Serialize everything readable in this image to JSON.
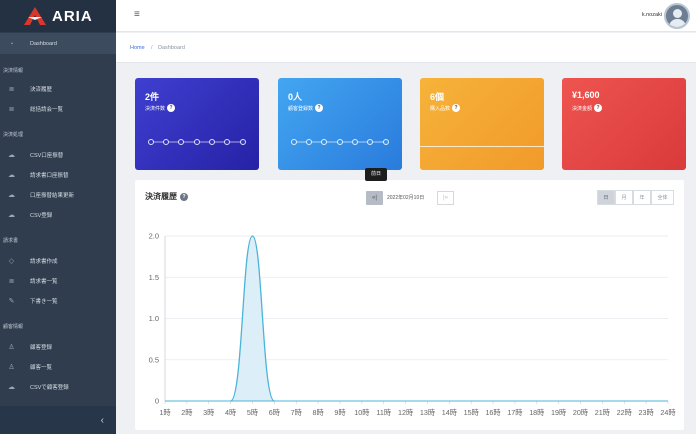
{
  "app": {
    "name": "ARIA",
    "brand_color": "#d9372b"
  },
  "sidebar": {
    "dashboard": {
      "label": "Dashboard",
      "icon": "dashboard-icon"
    },
    "sections": [
      {
        "title": "決済情報",
        "items": [
          {
            "label": "決済履歴",
            "icon": "document-icon"
          },
          {
            "label": "総括請会一覧",
            "icon": "document-icon"
          }
        ]
      },
      {
        "title": "決済処理",
        "items": [
          {
            "label": "CSV口座振替",
            "icon": "upload-icon"
          },
          {
            "label": "請求書口座振替",
            "icon": "upload-icon"
          },
          {
            "label": "口座振替結果更新",
            "icon": "upload-icon"
          },
          {
            "label": "CSV登録",
            "icon": "upload-icon"
          }
        ]
      },
      {
        "title": "請求書",
        "items": [
          {
            "label": "請求書作成",
            "icon": "diamond-icon"
          },
          {
            "label": "請求書一覧",
            "icon": "document-icon"
          },
          {
            "label": "下書き一覧",
            "icon": "pencil-icon"
          }
        ]
      },
      {
        "title": "顧客情報",
        "items": [
          {
            "label": "顧客登録",
            "icon": "user-icon"
          },
          {
            "label": "顧客一覧",
            "icon": "users-icon"
          },
          {
            "label": "CSVで顧客登録",
            "icon": "upload-icon"
          }
        ]
      }
    ],
    "collapse_icon": "chevron-left-icon"
  },
  "topbar": {
    "username": "k.nozaki",
    "menu_icon": "hamburger-icon"
  },
  "breadcrumb": {
    "home": "Home",
    "separator": "/",
    "current": "Dashboard"
  },
  "cards": [
    {
      "value": "2件",
      "label": "決済件数",
      "color": "#3333c0"
    },
    {
      "value": "0人",
      "label": "顧客登録数",
      "color": "#3590e8"
    },
    {
      "value": "6個",
      "label": "購入品数",
      "color": "#f4a733"
    },
    {
      "value": "¥1,600",
      "label": "決済金額",
      "color": "#e3464a"
    }
  ],
  "panel": {
    "title": "決済履歴",
    "help": "?",
    "tooltip": "前日",
    "prev_label": "«|",
    "date": "2022年02月10日",
    "next_label": "|»",
    "range_buttons": [
      {
        "label": "日",
        "active": true
      },
      {
        "label": "月",
        "active": false
      },
      {
        "label": "年",
        "active": false
      },
      {
        "label": "全体",
        "active": false
      }
    ]
  },
  "chart_data": {
    "type": "area",
    "categories": [
      "1時",
      "2時",
      "3時",
      "4時",
      "5時",
      "6時",
      "7時",
      "8時",
      "9時",
      "10時",
      "11時",
      "12時",
      "13時",
      "14時",
      "15時",
      "16時",
      "17時",
      "18時",
      "19時",
      "20時",
      "21時",
      "22時",
      "23時",
      "24時"
    ],
    "values": [
      0,
      0,
      0,
      0,
      2,
      0,
      0,
      0,
      0,
      0,
      0,
      0,
      0,
      0,
      0,
      0,
      0,
      0,
      0,
      0,
      0,
      0,
      0,
      0
    ],
    "y_ticks": [
      "0",
      "0.5",
      "1.0",
      "1.5",
      "2.0"
    ],
    "ylim": [
      0,
      2
    ],
    "line_color": "#4bb4d8",
    "fill_color": "#dceef8",
    "grid": true
  }
}
